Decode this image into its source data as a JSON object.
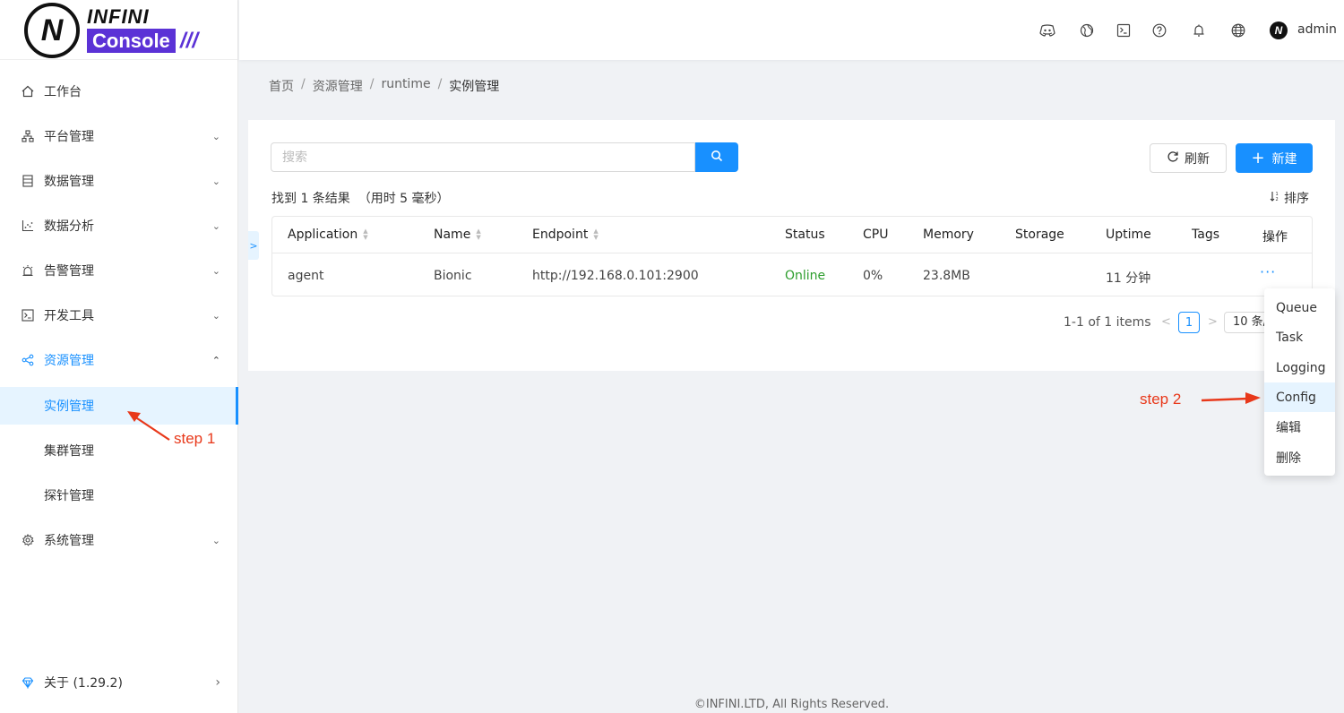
{
  "logo": {
    "mark": "N",
    "brand": "INFINI",
    "product": "Console",
    "slashes": "///"
  },
  "sidebar": {
    "items": [
      {
        "label": "工作台",
        "icon": "home-icon"
      },
      {
        "label": "平台管理",
        "icon": "cluster-icon"
      },
      {
        "label": "数据管理",
        "icon": "database-icon"
      },
      {
        "label": "数据分析",
        "icon": "chart-icon"
      },
      {
        "label": "告警管理",
        "icon": "alarm-icon"
      },
      {
        "label": "开发工具",
        "icon": "terminal-icon"
      },
      {
        "label": "资源管理",
        "icon": "share-icon"
      },
      {
        "label": "系统管理",
        "icon": "gear-icon"
      }
    ],
    "subitems": [
      {
        "label": "实例管理"
      },
      {
        "label": "集群管理"
      },
      {
        "label": "探针管理"
      }
    ],
    "about": "关于 (1.29.2)"
  },
  "header": {
    "icons": [
      "discord-icon",
      "globe-grid-icon",
      "terminal-icon",
      "help-icon",
      "bell-icon",
      "language-icon"
    ],
    "user": "admin"
  },
  "breadcrumb": [
    "首页",
    "资源管理",
    "runtime",
    "实例管理"
  ],
  "toolbar": {
    "search_placeholder": "搜索",
    "refresh_label": "刷新",
    "new_label": "新建",
    "result_info": "找到 1 条结果  （用时 5 毫秒）",
    "sort_label": "排序"
  },
  "table": {
    "columns": [
      "Application",
      "Name",
      "Endpoint",
      "Status",
      "CPU",
      "Memory",
      "Storage",
      "Uptime",
      "Tags",
      "操作"
    ],
    "rows": [
      {
        "application": "agent",
        "name": "Bionic",
        "endpoint": "http://192.168.0.101:2900",
        "status": "Online",
        "cpu": "0%",
        "memory": "23.8MB",
        "storage": "",
        "uptime": "11 分钟",
        "tags": "",
        "action": "···"
      }
    ]
  },
  "pagination": {
    "info": "1-1 of 1 items",
    "page": "1",
    "page_size": "10 条/页"
  },
  "dropdown": {
    "items": [
      "Queue",
      "Task",
      "Logging",
      "Config",
      "编辑",
      "删除"
    ],
    "highlighted": "Config"
  },
  "annotations": {
    "step1": "step 1",
    "step2": "step 2"
  },
  "footer": "©INFINI.LTD, All Rights Reserved.",
  "colors": {
    "primary": "#1890ff",
    "online": "#2e9e2e",
    "annotation": "#e8381a",
    "brand": "#5b32d6"
  }
}
